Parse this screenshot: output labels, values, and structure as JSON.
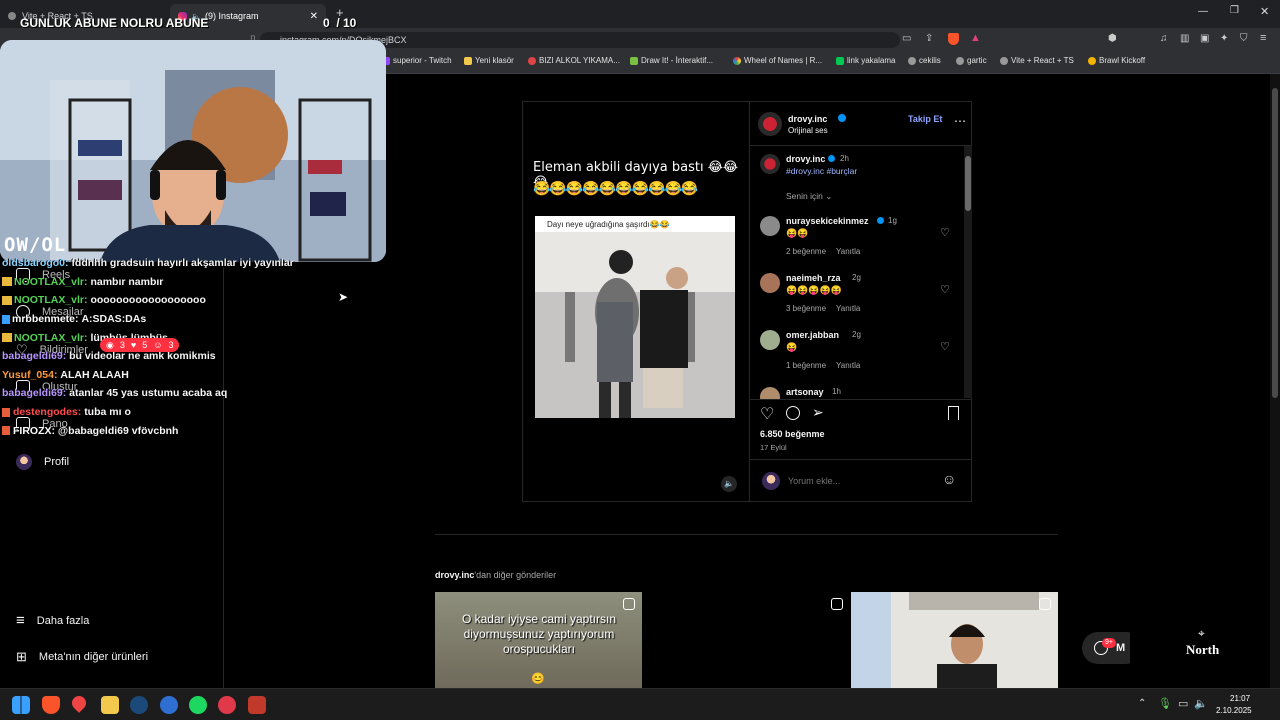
{
  "browser": {
    "tabs": [
      {
        "label": "Vite + React + TS"
      },
      {
        "label": "(9) Instagram"
      }
    ],
    "url": "instagram.com/p/DOsikmejBCX",
    "bookmarks": [
      "superior - Twitch",
      "Yeni klasör",
      "BIZI ALKOL YIKAMA...",
      "Draw It! - İnteraktif...",
      "Wheel of Names | R...",
      "link yakalama",
      "cekilis",
      "gartic",
      "Vite + React + TS",
      "Brawl Kickoff"
    ]
  },
  "overlay": {
    "title": "GUNLUK ABUNE NOLRU ABUNE",
    "counter": "0  / 10",
    "watermark": "OW/OL",
    "chat": [
      {
        "user": "oldsbarogo0:",
        "msg": "fddnhh gradsuin hayırlı akşamlar iyi yayınlar",
        "color": "#8bd4ff"
      },
      {
        "user": "NOOTLAX_vlr:",
        "msg": "nambır nambır",
        "color": "#56d156"
      },
      {
        "user": "NOOTLAX_vlr:",
        "msg": "oooooooooooooooooo",
        "color": "#56d156"
      },
      {
        "user": "mrbbenmete:",
        "msg": "A:SDAS:DAs",
        "color": "#ffffff"
      },
      {
        "user": "NOOTLAX_vlr:",
        "msg": "lümbüs lümbüs",
        "color": "#56d156"
      },
      {
        "user": "babageldi69:",
        "msg": "bu videolar ne amk komikmis",
        "color": "#b895ff"
      },
      {
        "user": "Yusuf_054:",
        "msg": "ALAH ALAAH",
        "color": "#ff9a3c"
      },
      {
        "user": "babageldi69:",
        "msg": "atanlar 45 yas ustumu acaba aq",
        "color": "#b895ff"
      },
      {
        "user": "destengodes:",
        "msg": "tuba mı o",
        "color": "#ff4d4d"
      },
      {
        "user": "FIROZX:",
        "msg": "@babageldi69 vfövcbnh",
        "color": "#ffffff"
      }
    ],
    "badges": [
      "3",
      "5",
      "3"
    ]
  },
  "nav": {
    "items": [
      {
        "label": "Reels"
      },
      {
        "label": "Mesajlar"
      },
      {
        "label": "Bildirimler"
      },
      {
        "label": "Oluştur"
      },
      {
        "label": "Pano"
      },
      {
        "label": "Profil"
      }
    ],
    "more": "Daha fazla",
    "meta": "Meta'nın diğer ürünleri",
    "messages_badge": "9+"
  },
  "post": {
    "username": "drovy.inc",
    "audio": "Orijinal ses",
    "follow": "Takip Et",
    "video_caption": "Eleman akbili dayıya bastı 😂😂😂",
    "inner_caption": "Dayı neye uğradığına şaşırdı😂😂",
    "caption_user": "drovy.inc",
    "caption_time": "2h",
    "caption_tags": "#drovy.inc #burçlar",
    "for_you": "Senin için",
    "comments": [
      {
        "user": "nuraysekicekinmez",
        "time": "1g",
        "text": "😝😝",
        "likes": "2 beğenme",
        "reply": "Yanıtla"
      },
      {
        "user": "naeimeh_rza",
        "time": "2g",
        "text": "😝😝😝😝😝",
        "likes": "3 beğenme",
        "reply": "Yanıtla"
      },
      {
        "user": "omer.jabban",
        "time": "2g",
        "text": "😝",
        "likes": "1 beğenme",
        "reply": "Yanıtla"
      },
      {
        "user": "artsonay",
        "time": "1h",
        "text": "",
        "likes": "",
        "reply": ""
      }
    ],
    "likes": "6.850 beğenme",
    "date": "17 Eylül",
    "comment_placeholder": "Yorum ekle..."
  },
  "more_posts": {
    "heading_user": "drovy.inc",
    "heading_rest": "'dan diğer gönderiler",
    "thumb1_text": "O kadar iyiyse cami yaptırsın diyormuşsunuz yaptırıyorum orospucukları",
    "thumb1_emoji": "😊"
  },
  "messages_pill": {
    "label": "M",
    "badge": "9+"
  },
  "north": "North",
  "taskbar": {
    "time": "21:07",
    "date": "2.10.2025"
  }
}
